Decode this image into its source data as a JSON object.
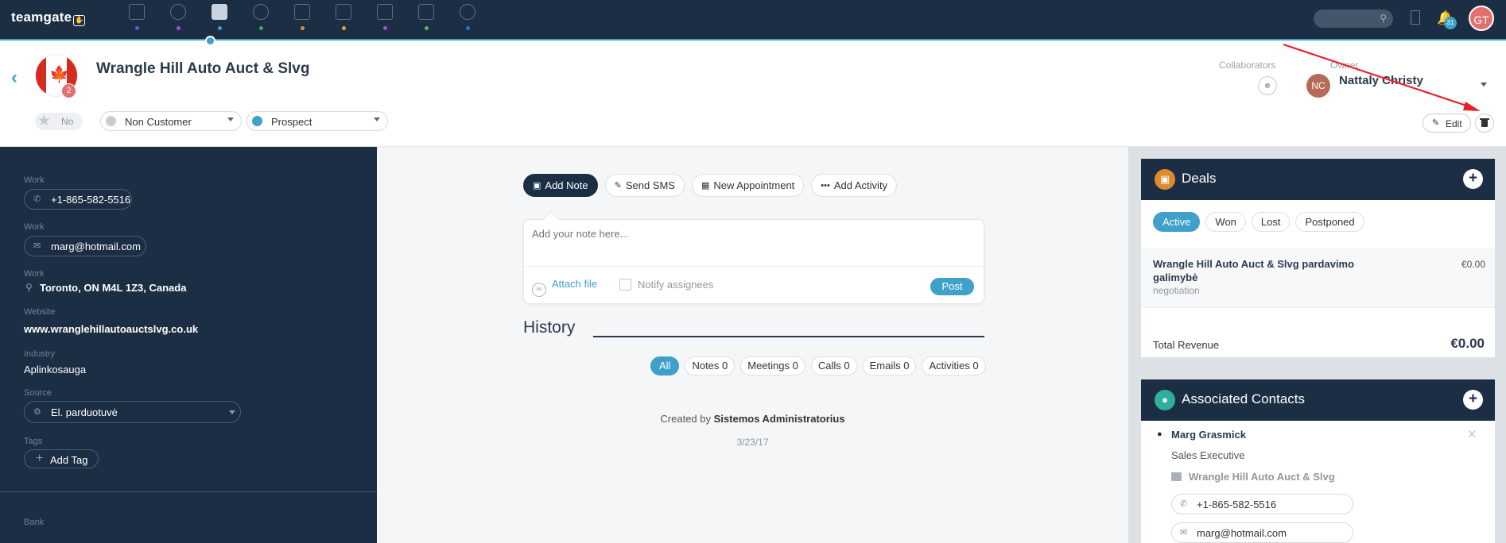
{
  "app": {
    "logo": "teamgate",
    "nav": [
      {
        "name": "nav-dashboard",
        "icon": "dashboard-icon",
        "dot_color": "#5a5fd6"
      },
      {
        "name": "nav-goals",
        "icon": "target-icon",
        "dot_color": "#a050d6"
      },
      {
        "name": "nav-companies",
        "icon": "book-icon",
        "dot_color": "#3fa0c9"
      },
      {
        "name": "nav-people",
        "icon": "person-icon",
        "dot_color": "#2fae5b"
      },
      {
        "name": "nav-deals",
        "icon": "briefcase-icon",
        "dot_color": "#e08a2e"
      },
      {
        "name": "nav-calendar",
        "icon": "calendar-icon",
        "dot_color": "#d6a82e"
      },
      {
        "name": "nav-tasks",
        "icon": "clipboard-icon",
        "dot_color": "#a050d6"
      },
      {
        "name": "nav-notes",
        "icon": "note-icon",
        "dot_color": "#5cb85c"
      },
      {
        "name": "nav-reports",
        "icon": "pie-icon",
        "dot_color": "#2f6fd6"
      }
    ],
    "notification_count": "31",
    "user_initials": "GT"
  },
  "header": {
    "company_name": "Wrangle Hill Auto Auct & Slvg",
    "flag_badge": "2",
    "star_label": "No",
    "status_select": "Non Customer",
    "type_select": "Prospect",
    "collaborators_label": "Collaborators",
    "owner_label": "Owner",
    "owner_initials": "NC",
    "owner_name": "Nattaly Christy",
    "edit_label": "Edit"
  },
  "sidebar": {
    "phone_label": "Work",
    "phone": "+1-865-582-5516",
    "email_label": "Work",
    "email": "marg@hotmail.com",
    "address_label": "Work",
    "address": "Toronto, ON M4L 1Z3, Canada",
    "website_label": "Website",
    "website": "www.wranglehillautoauctslvg.co.uk",
    "industry_label": "Industry",
    "industry": "Aplinkosauga",
    "source_label": "Source",
    "source": "El. parduotuvė",
    "tags_label": "Tags",
    "add_tag": "Add Tag",
    "bank_label": "Bank"
  },
  "center": {
    "actions": [
      {
        "label": "Add Note",
        "icon": "note-icon",
        "glyph": "▣"
      },
      {
        "label": "Send SMS",
        "icon": "sms-icon",
        "glyph": "✎"
      },
      {
        "label": "New Appointment",
        "icon": "calendar-icon",
        "glyph": "▦"
      },
      {
        "label": "Add Activity",
        "icon": "more-icon",
        "glyph": "•••"
      }
    ],
    "note_placeholder": "Add your note here...",
    "attach_file": "Attach file",
    "notify_assignees": "Notify assignees",
    "post": "Post",
    "history_title": "History",
    "filters": [
      "All",
      "Notes 0",
      "Meetings 0",
      "Calls 0",
      "Emails 0",
      "Activities 0"
    ],
    "created_by_prefix": "Created by",
    "created_by": "Sistemos Administratorius",
    "created_date": "3/23/17"
  },
  "deals": {
    "title": "Deals",
    "tabs": [
      "Active",
      "Won",
      "Lost",
      "Postponed"
    ],
    "deal_name": "Wrangle Hill Auto Auct & Slvg pardavimo galimybė",
    "deal_stage": "negotiation",
    "deal_amount": "€0.00",
    "total_label": "Total Revenue",
    "total_value": "€0.00"
  },
  "contacts": {
    "title": "Associated Contacts",
    "name": "Marg Grasmick",
    "job_title": "Sales Executive",
    "company": "Wrangle Hill Auto Auct & Slvg",
    "phone": "+1-865-582-5516",
    "email": "marg@hotmail.com"
  },
  "colors": {
    "nav_bg": "#1c2e44",
    "accent": "#3fa0c9",
    "annotation_arrow": "#e8202a"
  }
}
